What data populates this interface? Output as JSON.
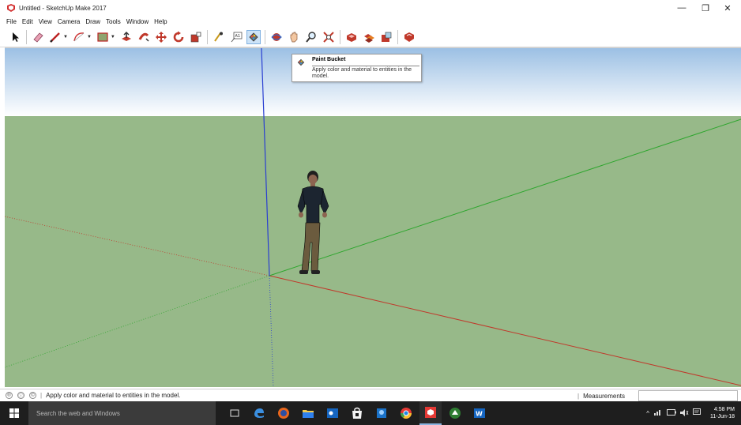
{
  "window": {
    "title": "Untitled - SketchUp Make 2017"
  },
  "menu": [
    "File",
    "Edit",
    "View",
    "Camera",
    "Draw",
    "Tools",
    "Window",
    "Help"
  ],
  "toolbar": {
    "tools": [
      "select",
      "eraser",
      "line",
      "arc",
      "shape",
      "push-pull",
      "follow-me",
      "move",
      "rotate",
      "scale",
      "tape-measure",
      "text",
      "paint-bucket",
      "orbit",
      "pan",
      "zoom",
      "zoom-extents",
      "components",
      "materials",
      "layers",
      "extension-warehouse"
    ],
    "active_tool": "paint-bucket"
  },
  "tooltip": {
    "title": "Paint Bucket",
    "body": "Apply color and material to entities in the model."
  },
  "statusbar": {
    "text": "Apply color and material to entities in the model.",
    "measurements_label": "Measurements",
    "measurements_value": ""
  },
  "taskbar": {
    "search_placeholder": "Search the web and Windows",
    "time": "4:58 PM",
    "date": "11-Jun-18"
  },
  "colors": {
    "sky_top": "#9cc0e4",
    "ground": "#97b989",
    "axis_red": "#c0392b",
    "axis_green": "#2ea62e",
    "axis_blue": "#2a3fd1"
  }
}
